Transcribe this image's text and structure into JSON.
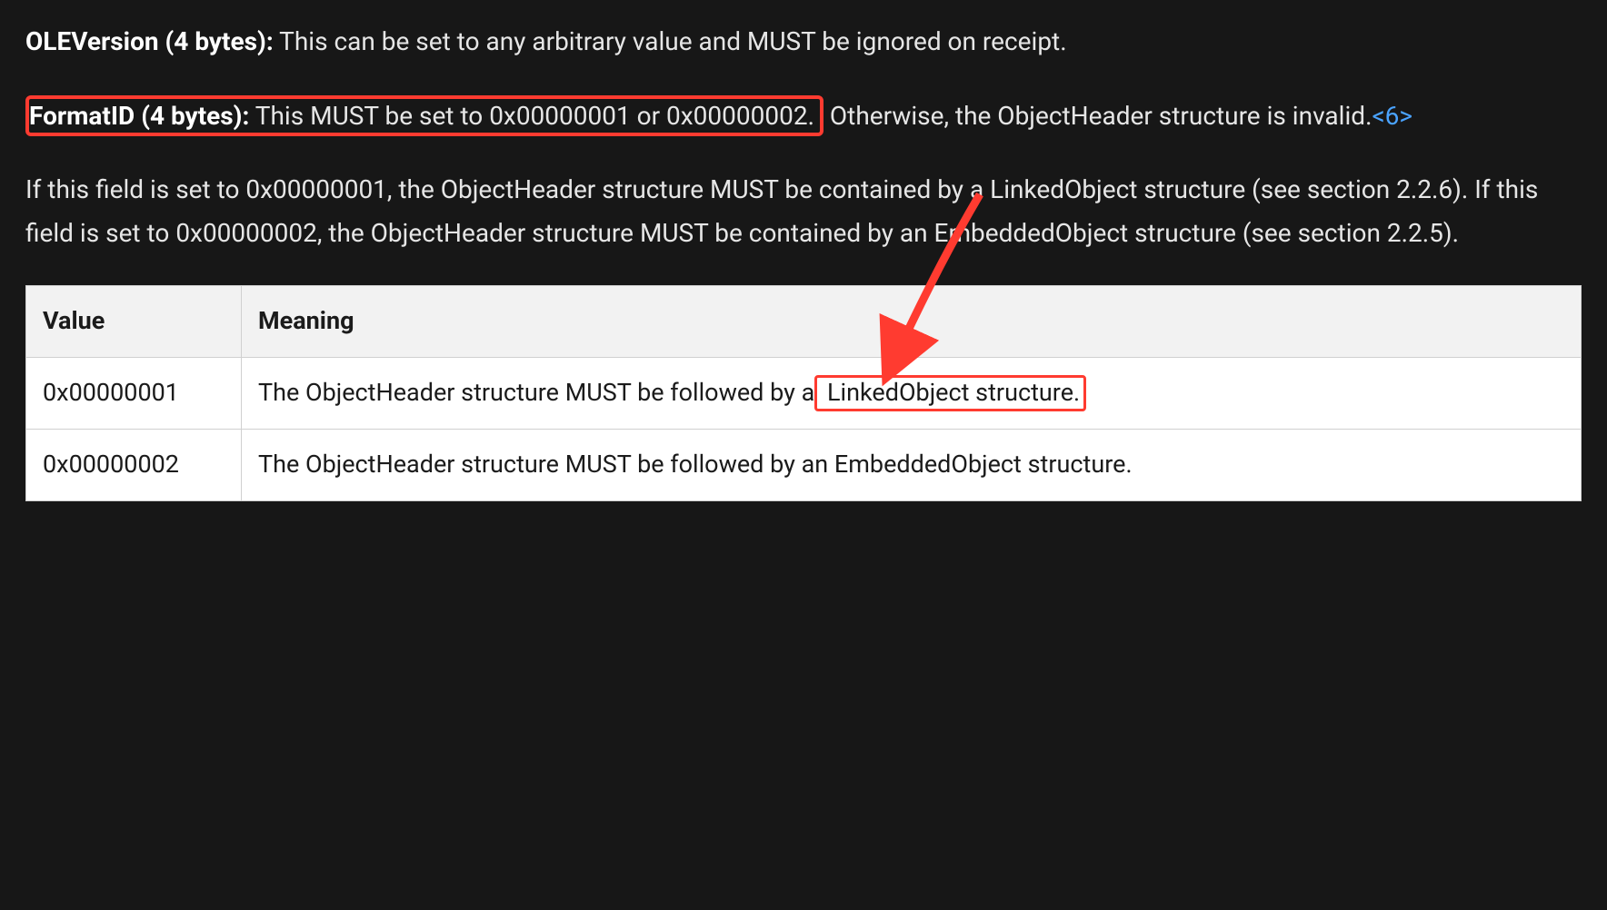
{
  "para1": {
    "field": "OLEVersion (4 bytes):",
    "text": " This can be set to any arbitrary value and MUST be ignored on receipt."
  },
  "para2": {
    "field": "FormatID (4 bytes):",
    "hl_text": " This MUST be set to 0x00000001 or 0x00000002.",
    "rest": " Otherwise, the ObjectHeader structure is invalid.",
    "footnote": "<6>"
  },
  "para3": {
    "text": "If this field is set to 0x00000001, the ObjectHeader structure MUST be contained by a LinkedObject structure (see section 2.2.6). If this field is set to 0x00000002, the ObjectHeader structure MUST be contained by an EmbeddedObject structure (see section 2.2.5)."
  },
  "table": {
    "headers": {
      "value": "Value",
      "meaning": "Meaning"
    },
    "rows": [
      {
        "value": "0x00000001",
        "meaning_pre": "The ObjectHeader structure MUST be followed by a",
        "meaning_hl": " LinkedObject structure.",
        "meaning_post": ""
      },
      {
        "value": "0x00000002",
        "meaning_pre": "The ObjectHeader structure MUST be followed by an EmbeddedObject structure.",
        "meaning_hl": "",
        "meaning_post": ""
      }
    ]
  },
  "annotation": {
    "color": "#ff3b30"
  }
}
